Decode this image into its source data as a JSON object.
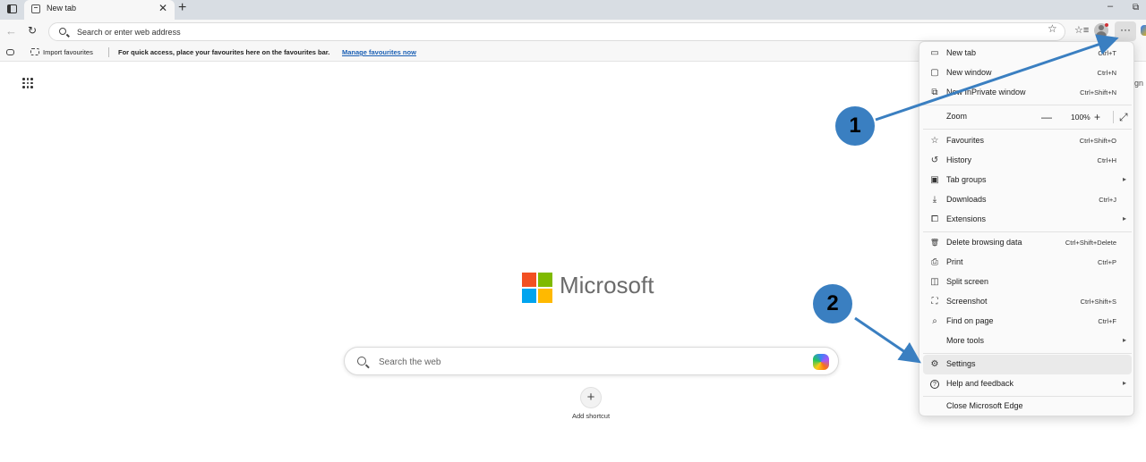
{
  "tab": {
    "title": "New tab",
    "close": "✕"
  },
  "toolbar": {
    "newtab_glyph": "+",
    "back_glyph": "←",
    "refresh_glyph": "↻",
    "address_placeholder": "Search or enter web address",
    "star_glyph": "☆",
    "favbar_glyph": "☆≡",
    "menu_glyph": "···",
    "minimize_glyph": "–",
    "restore_glyph": "⧉"
  },
  "favbar": {
    "import_label": "Import favourites",
    "hint_text": "For quick access, place your favourites here on the favourites bar.",
    "manage_link": "Manage favourites now"
  },
  "page": {
    "sign_fragment": "ign",
    "brand": "Microsoft",
    "brand_colors": [
      "#f25022",
      "#7fba00",
      "#00a4ef",
      "#ffb900"
    ],
    "search_placeholder": "Search the web",
    "add_shortcut_glyph": "+",
    "add_shortcut_label": "Add shortcut"
  },
  "menu": {
    "items": [
      {
        "label": "New tab",
        "shortcut": "Ctrl+T",
        "icon": "new-tab-icon",
        "glyph": "▭"
      },
      {
        "label": "New window",
        "shortcut": "Ctrl+N",
        "icon": "new-window-icon",
        "glyph": "▢"
      },
      {
        "label": "New InPrivate window",
        "shortcut": "Ctrl+Shift+N",
        "icon": "inprivate-icon",
        "glyph": "⧉"
      },
      {
        "label": "Zoom",
        "icon": "zoom-icon",
        "glyph": ""
      },
      {
        "label": "Favourites",
        "shortcut": "Ctrl+Shift+O",
        "icon": "favourites-icon",
        "glyph": "☆"
      },
      {
        "label": "History",
        "shortcut": "Ctrl+H",
        "icon": "history-icon",
        "glyph": "↺"
      },
      {
        "label": "Tab groups",
        "icon": "tab-groups-icon",
        "glyph": "▣",
        "arrow": "▸"
      },
      {
        "label": "Downloads",
        "shortcut": "Ctrl+J",
        "icon": "downloads-icon",
        "glyph": "⤓"
      },
      {
        "label": "Extensions",
        "icon": "extensions-icon",
        "glyph": "⧠",
        "arrow": "▸"
      },
      {
        "label": "Delete browsing data",
        "shortcut": "Ctrl+Shift+Delete",
        "icon": "trash-icon",
        "glyph": "🗑"
      },
      {
        "label": "Print",
        "shortcut": "Ctrl+P",
        "icon": "print-icon",
        "glyph": "⎙"
      },
      {
        "label": "Split screen",
        "icon": "split-screen-icon",
        "glyph": "◫"
      },
      {
        "label": "Screenshot",
        "shortcut": "Ctrl+Shift+S",
        "icon": "screenshot-icon",
        "glyph": "⛶"
      },
      {
        "label": "Find on page",
        "shortcut": "Ctrl+F",
        "icon": "find-icon",
        "glyph": "⌕"
      },
      {
        "label": "More tools",
        "icon": "",
        "glyph": "",
        "arrow": "▸"
      },
      {
        "label": "Settings",
        "icon": "gear-icon",
        "glyph": "⚙"
      },
      {
        "label": "Help and feedback",
        "icon": "help-icon",
        "glyph": "?",
        "arrow": "▸"
      },
      {
        "label": "Close Microsoft Edge",
        "icon": "",
        "glyph": ""
      }
    ],
    "zoom": {
      "minus": "—",
      "value": "100%",
      "plus": "+",
      "fullscreen": "⤢"
    }
  },
  "annotations": {
    "callout_1": "1",
    "callout_2": "2",
    "arrow_color": "#3a7fc1"
  }
}
